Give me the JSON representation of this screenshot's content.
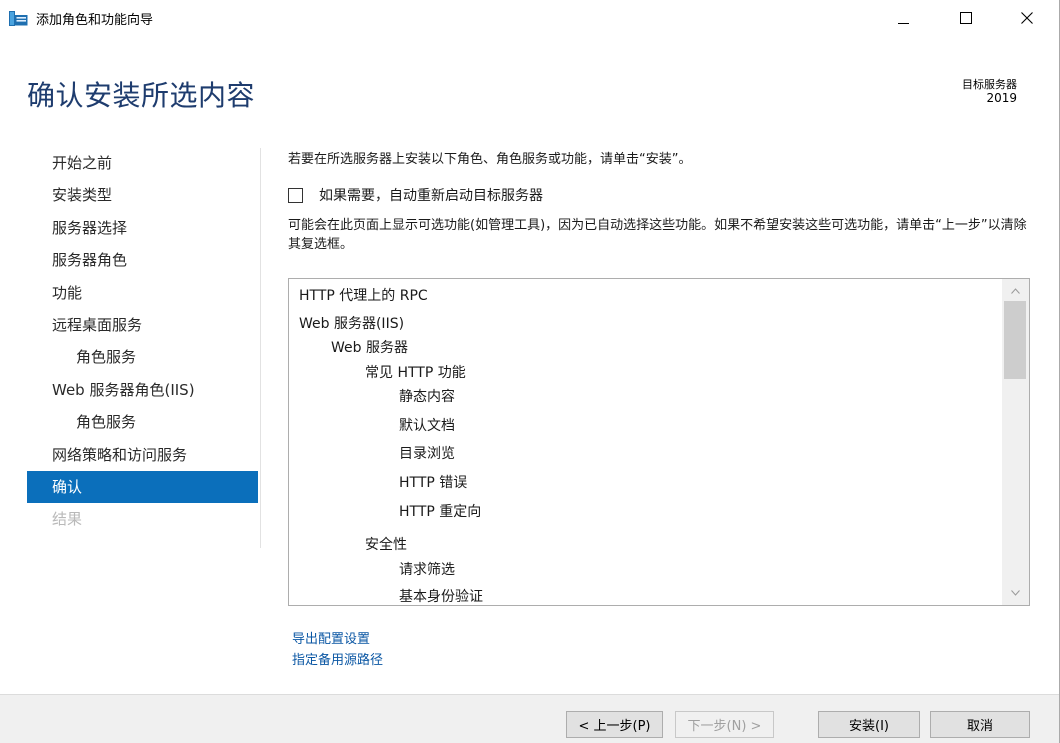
{
  "window": {
    "title": "添加角色和功能向导"
  },
  "header": {
    "title": "确认安装所选内容",
    "target_label": "目标服务器",
    "target_value": "2019"
  },
  "nav": {
    "items": [
      {
        "label": "开始之前",
        "state": "normal",
        "sub": false
      },
      {
        "label": "安装类型",
        "state": "normal",
        "sub": false
      },
      {
        "label": "服务器选择",
        "state": "normal",
        "sub": false
      },
      {
        "label": "服务器角色",
        "state": "normal",
        "sub": false
      },
      {
        "label": "功能",
        "state": "normal",
        "sub": false
      },
      {
        "label": "远程桌面服务",
        "state": "normal",
        "sub": false
      },
      {
        "label": "角色服务",
        "state": "normal",
        "sub": true
      },
      {
        "label": "Web 服务器角色(IIS)",
        "state": "normal",
        "sub": false
      },
      {
        "label": "角色服务",
        "state": "normal",
        "sub": true
      },
      {
        "label": "网络策略和访问服务",
        "state": "normal",
        "sub": false
      },
      {
        "label": "确认",
        "state": "active",
        "sub": false
      },
      {
        "label": "结果",
        "state": "disabled",
        "sub": false
      }
    ]
  },
  "main": {
    "intro": "若要在所选服务器上安装以下角色、角色服务或功能，请单击“安装”。",
    "restart_checkbox": {
      "label": "如果需要，自动重新启动目标服务器",
      "checked": false
    },
    "note": "可能会在此页面上显示可选功能(如管理工具)，因为已自动选择这些功能。如果不希望安装这些可选功能，请单击“上一步”以清除其复选框。",
    "items": [
      {
        "label": "HTTP 代理上的 RPC",
        "level": 0
      },
      {
        "label": "Web 服务器(IIS)",
        "level": 0
      },
      {
        "label": "Web 服务器",
        "level": 1
      },
      {
        "label": "常见 HTTP 功能",
        "level": 2
      },
      {
        "label": "静态内容",
        "level": 3
      },
      {
        "label": "默认文档",
        "level": 3
      },
      {
        "label": "目录浏览",
        "level": 3
      },
      {
        "label": "HTTP 错误",
        "level": 3
      },
      {
        "label": "HTTP 重定向",
        "level": 3
      },
      {
        "label": "安全性",
        "level": 2
      },
      {
        "label": "请求筛选",
        "level": 3
      },
      {
        "label": "基本身份验证",
        "level": 3
      }
    ],
    "links": {
      "export": "导出配置设置",
      "alt_source": "指定备用源路径"
    }
  },
  "footer": {
    "prev": "< 上一步(P)",
    "next": "下一步(N) >",
    "install": "安装(I)",
    "cancel": "取消"
  },
  "colors": {
    "accent": "#0b6fbb",
    "title": "#1e3c6e",
    "link": "#0b57a4"
  }
}
